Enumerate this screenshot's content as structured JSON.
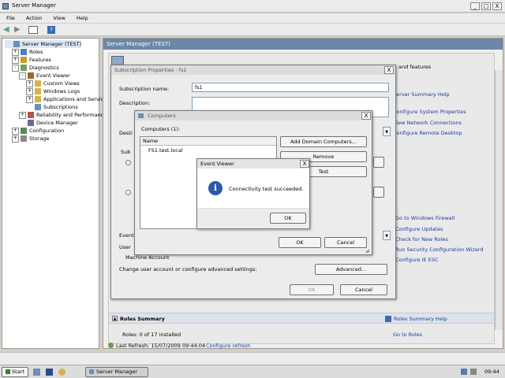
{
  "window": {
    "title": "Server Manager",
    "minimize": "_",
    "maximize": "□",
    "close": "X"
  },
  "menu": [
    "File",
    "Action",
    "View",
    "Help"
  ],
  "tree": [
    {
      "label": "Server Manager (TEST)",
      "exp": "",
      "indent": 0,
      "icon": "#6a8fb8"
    },
    {
      "label": "Roles",
      "exp": "+",
      "indent": 1,
      "icon": "#4f7fbf"
    },
    {
      "label": "Features",
      "exp": "+",
      "indent": 1,
      "icon": "#c89b2c"
    },
    {
      "label": "Diagnostics",
      "exp": "-",
      "indent": 1,
      "icon": "#7a9f5a"
    },
    {
      "label": "Event Viewer",
      "exp": "-",
      "indent": 2,
      "icon": "#9a6a2a"
    },
    {
      "label": "Custom Views",
      "exp": "+",
      "indent": 3,
      "icon": "#d6b24a"
    },
    {
      "label": "Windows Logs",
      "exp": "+",
      "indent": 3,
      "icon": "#d6b24a"
    },
    {
      "label": "Applications and Servic",
      "exp": "+",
      "indent": 3,
      "icon": "#d6b24a"
    },
    {
      "label": "Subscriptions",
      "exp": "",
      "indent": 3,
      "icon": "#6a8fb8"
    },
    {
      "label": "Reliability and Performanc",
      "exp": "+",
      "indent": 2,
      "icon": "#b85050"
    },
    {
      "label": "Device Manager",
      "exp": "",
      "indent": 2,
      "icon": "#6a6a9a"
    },
    {
      "label": "Configuration",
      "exp": "+",
      "indent": 1,
      "icon": "#5a8a5a"
    },
    {
      "label": "Storage",
      "exp": "+",
      "indent": 1,
      "icon": "#8a8a8a"
    }
  ],
  "main": {
    "header": "Server Manager (TEST)",
    "right_snippet": "and features",
    "server_summary_help": "Server Summary Help",
    "right_links": [
      "Configure System Properties",
      "View Network Connections",
      "Configure Remote Desktop"
    ],
    "right_links2": [
      "Go to Windows Firewall",
      "Configure Updates",
      "Check for New Roles",
      "Run Security Configuration Wizard",
      "Configure IE ESC"
    ],
    "roles_summary": "Roles Summary",
    "roles_summary_help": "Roles Summary Help",
    "roles_count": "Roles: 0 of 17 installed",
    "go_to_roles": "Go to Roles",
    "last_refresh": "Last Refresh: 15/07/2009 09:44:04",
    "configure_refresh": "Configure refresh"
  },
  "subscription_dialog": {
    "title": "Subscription Properties - fs1",
    "name_label": "Subscription name:",
    "name_value": "fs1",
    "desc_label": "Description:",
    "dest_label": "Desti",
    "sub_type_label": "Sub",
    "events_label": "Event",
    "user_label": "User",
    "machine_account": "Machine Account",
    "change_user": "Change user account or configure advanced settings:",
    "advanced": "Advanced...",
    "ok": "OK",
    "cancel": "Cancel"
  },
  "computers_dialog": {
    "title": "Computers",
    "computers_label": "Computers (1):",
    "name_col": "Name",
    "row": "FS1.test.local",
    "add_domain": "Add Domain Computers...",
    "remove": "Remove",
    "test": "Test",
    "ok": "OK",
    "cancel": "Cancel"
  },
  "message_box": {
    "title": "Event Viewer",
    "message": "Connectivity test succeeded.",
    "ok": "OK",
    "info_glyph": "i"
  },
  "taskbar": {
    "start": "Start",
    "task": "Server Manager",
    "clock": "09:44"
  },
  "colors": {
    "accent_blue": "#1a3c9e",
    "title_blue": "#2a5aa8",
    "taskbar": "#dcdcdc"
  }
}
